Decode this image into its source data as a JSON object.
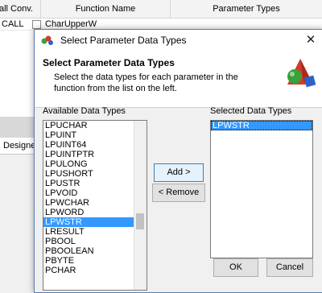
{
  "background": {
    "columns": [
      "all Conv.",
      "Function Name",
      "Parameter Types"
    ],
    "row": {
      "conv": "CALL",
      "function": "CharUpperW"
    },
    "tab_label": "Designe"
  },
  "dialog": {
    "title": "Select Parameter Data Types",
    "close_glyph": "✕",
    "header_title": "Select Parameter Data Types",
    "header_desc": "Select the data types for each parameter in the function from the list on the left.",
    "available_label": "Available Data Types",
    "selected_label": "Selected Data Types",
    "available_types": [
      "LPUCHAR",
      "LPUINT",
      "LPUINT64",
      "LPUINTPTR",
      "LPULONG",
      "LPUSHORT",
      "LPUSTR",
      "LPVOID",
      "LPWCHAR",
      "LPWORD",
      "LPWSTR",
      "LRESULT",
      "PBOOL",
      "PBOOLEAN",
      "PBYTE",
      "PCHAR"
    ],
    "available_selected_index": 10,
    "selected_types": [
      "LPWSTR"
    ],
    "add_button": "Add >",
    "remove_button": "< Remove",
    "ok_button": "OK",
    "cancel_button": "Cancel"
  },
  "colors": {
    "selection": "#3399ff",
    "accent": "#3c7fb1"
  },
  "icons": {
    "title": "molecule-icon",
    "header": "shapes-graphic-icon",
    "close": "close-icon"
  }
}
